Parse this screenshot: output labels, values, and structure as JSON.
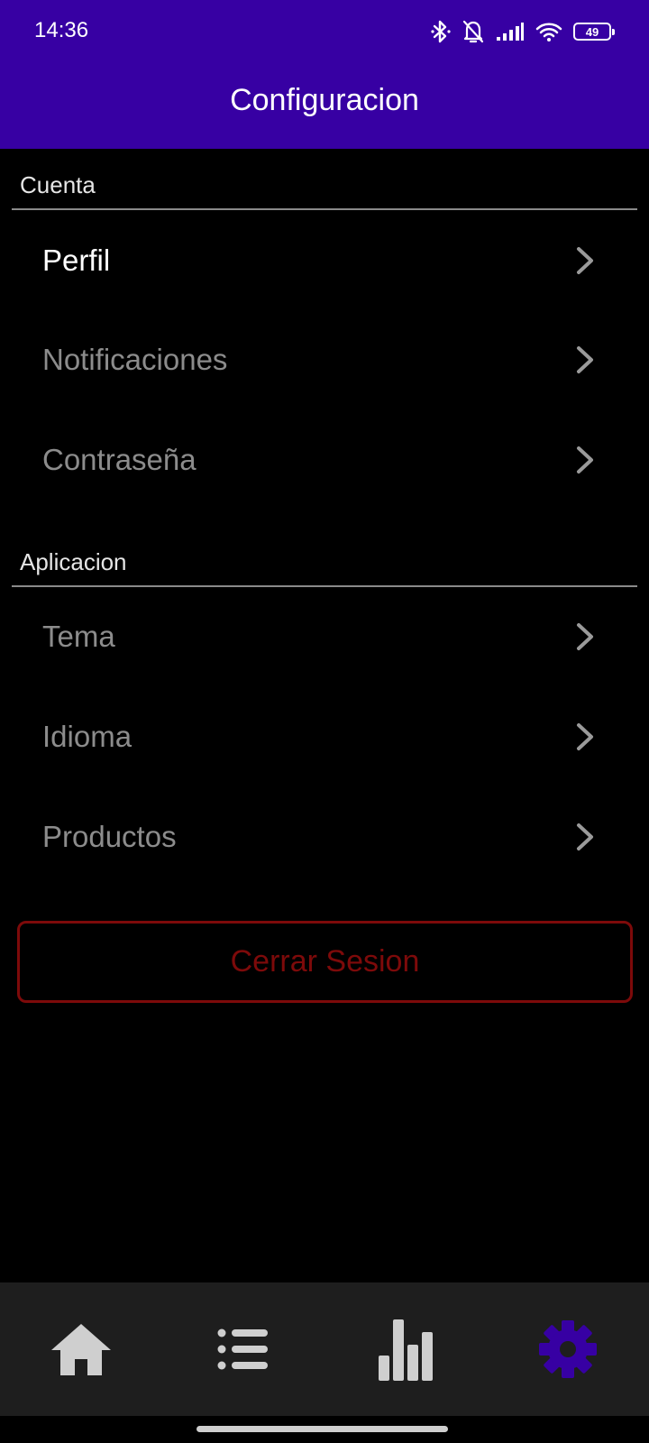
{
  "status_bar": {
    "time": "14:36",
    "battery": "49",
    "icons": [
      "bluetooth-icon",
      "notifications-off-icon",
      "signal-icon",
      "wifi-icon",
      "battery-icon"
    ]
  },
  "app_bar": {
    "title": "Configuracion"
  },
  "sections": [
    {
      "header": "Cuenta",
      "items": [
        {
          "label": "Perfil",
          "active": true
        },
        {
          "label": "Notificaciones",
          "active": false
        },
        {
          "label": "Contraseña",
          "active": false
        }
      ]
    },
    {
      "header": "Aplicacion",
      "items": [
        {
          "label": "Tema",
          "active": false
        },
        {
          "label": "Idioma",
          "active": false
        },
        {
          "label": "Productos",
          "active": false
        }
      ]
    }
  ],
  "logout_label": "Cerrar Sesion",
  "bottom_nav": [
    {
      "icon": "home-icon",
      "selected": false
    },
    {
      "icon": "list-icon",
      "selected": false
    },
    {
      "icon": "bar-chart-icon",
      "selected": false
    },
    {
      "icon": "gear-icon",
      "selected": true
    }
  ],
  "colors": {
    "app_bar": "#3700a3",
    "active_nav": "#3700a3",
    "inactive_nav": "#cfcfcf",
    "logout": "#7d0a0a"
  }
}
